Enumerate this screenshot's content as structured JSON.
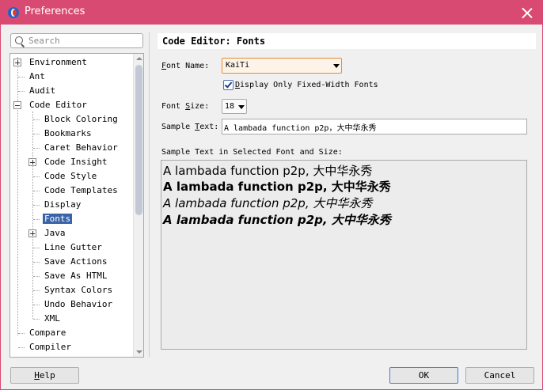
{
  "window": {
    "title": "Preferences"
  },
  "search": {
    "placeholder": "Search"
  },
  "tree": {
    "environment": "Environment",
    "ant": "Ant",
    "audit": "Audit",
    "code_editor": "Code Editor",
    "block_coloring": "Block Coloring",
    "bookmarks": "Bookmarks",
    "caret_behavior": "Caret Behavior",
    "code_insight": "Code Insight",
    "code_style": "Code Style",
    "code_templates": "Code Templates",
    "display": "Display",
    "fonts": "Fonts",
    "java": "Java",
    "line_gutter": "Line Gutter",
    "save_actions": "Save Actions",
    "save_as_html": "Save As HTML",
    "syntax_colors": "Syntax Colors",
    "undo_behavior": "Undo Behavior",
    "xml": "XML",
    "compare": "Compare",
    "compiler": "Compiler",
    "selected": "Fonts"
  },
  "panel": {
    "title": "Code Editor: Fonts",
    "font_name_first": "F",
    "font_name_rest": "ont Name:",
    "font_name_value": "KaiTi",
    "fixed_width_first": "D",
    "fixed_width_rest": "isplay Only Fixed-Width Fonts",
    "fixed_width_checked": true,
    "font_size_pre": "Font ",
    "font_size_mnemonic": "S",
    "font_size_post": "ize:",
    "font_size_value": "18",
    "sample_text_pre": "Sample ",
    "sample_text_mnemonic": "T",
    "sample_text_post": "ext:",
    "sample_text_value": "A lambada function p2p，大中华永秀",
    "preview_label": "Sample Text in Selected Font and Size:",
    "preview_regular": "A lambada function p2p, 大中华永秀",
    "preview_bold": "A lambada function p2p, 大中华永秀",
    "preview_italic": "A lambada function p2p, 大中华永秀",
    "preview_bold_italic": "A lambada function p2p, 大中华永秀"
  },
  "buttons": {
    "help_mnemonic": "H",
    "help_rest": "elp",
    "ok": "OK",
    "cancel": "Cancel"
  },
  "colors": {
    "titlebar": "#d94a72",
    "selection": "#3a64a8",
    "combo_focus_border": "#e58a3a"
  }
}
